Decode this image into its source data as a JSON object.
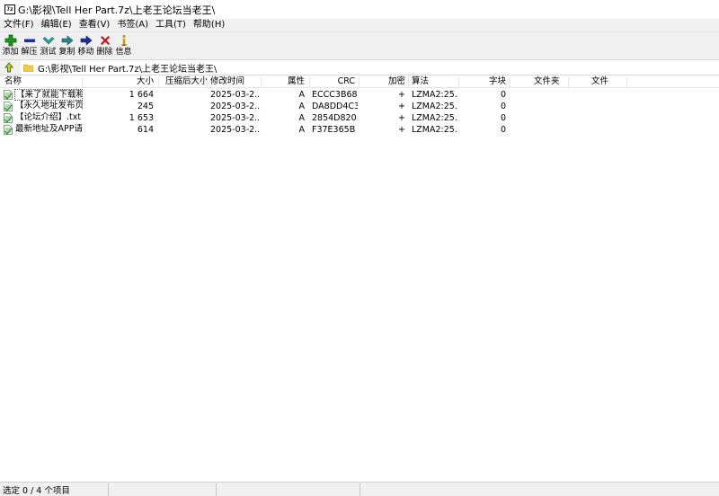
{
  "window": {
    "title": "G:\\影视\\Tell Her Part.7z\\上老王论坛当老王\\",
    "app_icon_text": "7z"
  },
  "menu": [
    "文件(F)",
    "编辑(E)",
    "查看(V)",
    "书签(A)",
    "工具(T)",
    "帮助(H)"
  ],
  "toolbar": [
    {
      "label": "添加",
      "icon": "add-icon"
    },
    {
      "label": "解压",
      "icon": "extract-icon"
    },
    {
      "label": "测试",
      "icon": "test-icon"
    },
    {
      "label": "复制",
      "icon": "copy-icon"
    },
    {
      "label": "移动",
      "icon": "move-icon"
    },
    {
      "label": "删除",
      "icon": "delete-icon"
    },
    {
      "label": "信息",
      "icon": "info-icon"
    }
  ],
  "address": {
    "path": "G:\\影视\\Tell Her Part.7z\\上老王论坛当老王\\"
  },
  "columns": [
    "名称",
    "大小",
    "压缩后大小",
    "修改时间",
    "属性",
    "CRC",
    "加密",
    "算法",
    "字块",
    "文件夹",
    "文件"
  ],
  "files": [
    {
      "name": "【来了就能下载和...",
      "size": "1 664",
      "packed": "",
      "modified": "2025-03-2...",
      "attr": "A",
      "crc": "ECCC3B68",
      "encrypted": "+",
      "method": "LZMA2:25...",
      "block": "0",
      "folders": "",
      "files": ""
    },
    {
      "name": "【永久地址发布页...",
      "size": "245",
      "packed": "",
      "modified": "2025-03-2...",
      "attr": "A",
      "crc": "DA8DD4C3",
      "encrypted": "+",
      "method": "LZMA2:25...",
      "block": "0",
      "folders": "",
      "files": ""
    },
    {
      "name": "【论坛介绍】.txt",
      "size": "1 653",
      "packed": "",
      "modified": "2025-03-2...",
      "attr": "A",
      "crc": "2854D820",
      "encrypted": "+",
      "method": "LZMA2:25...",
      "block": "0",
      "folders": "",
      "files": ""
    },
    {
      "name": "最新地址及APP请...",
      "size": "614",
      "packed": "",
      "modified": "2025-03-2...",
      "attr": "A",
      "crc": "F37E365B",
      "encrypted": "+",
      "method": "LZMA2:25...",
      "block": "0",
      "folders": "",
      "files": ""
    }
  ],
  "status": {
    "selection": "选定 0 / 4 个项目"
  },
  "colors": {
    "add": "#1a9a1a",
    "extract": "#1c2fa0",
    "test": "#23a0a0",
    "copy": "#23878a",
    "move": "#1c2fa0",
    "delete": "#d0101a",
    "info": "#c8a000"
  }
}
